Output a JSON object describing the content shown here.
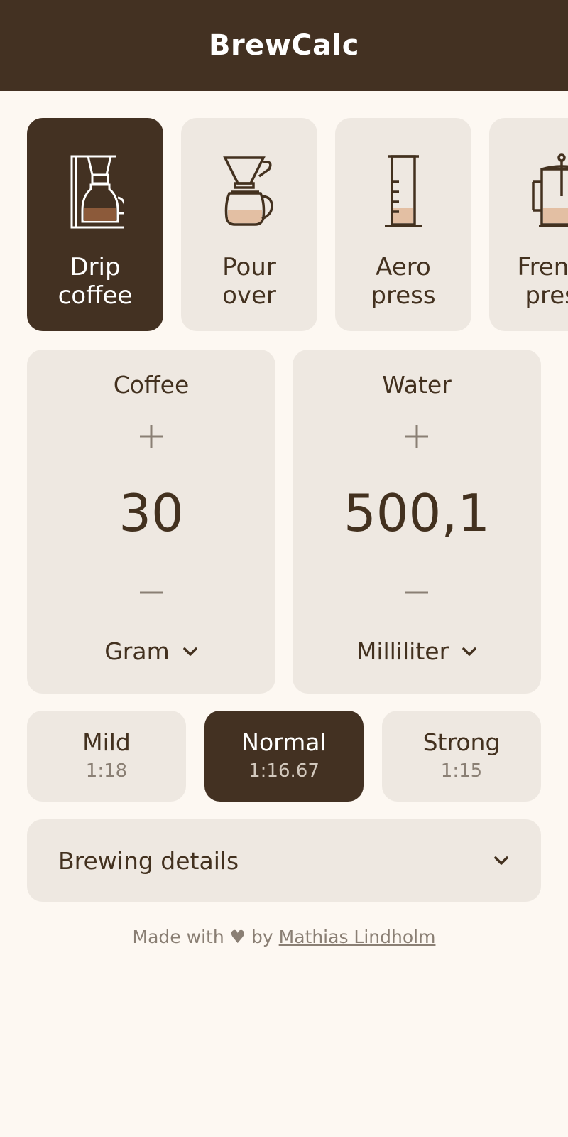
{
  "app": {
    "title": "BrewCalc"
  },
  "methods": [
    {
      "label": "Drip\ncoffee",
      "icon": "drip-coffee-maker-icon",
      "active": true
    },
    {
      "label": "Pour\nover",
      "icon": "pour-over-icon",
      "active": false
    },
    {
      "label": "Aero\npress",
      "icon": "aeropress-icon",
      "active": false
    },
    {
      "label": "French\npress",
      "icon": "french-press-icon",
      "active": false
    }
  ],
  "coffee": {
    "title": "Coffee",
    "value": "30",
    "unit": "Gram"
  },
  "water": {
    "title": "Water",
    "value": "500,1",
    "unit": "Milliliter"
  },
  "strengths": [
    {
      "name": "Mild",
      "ratio": "1:18",
      "active": false
    },
    {
      "name": "Normal",
      "ratio": "1:16.67",
      "active": true
    },
    {
      "name": "Strong",
      "ratio": "1:15",
      "active": false
    }
  ],
  "details": {
    "title": "Brewing details"
  },
  "footer": {
    "prefix": "Made with",
    "heart": "♥",
    "by": "by",
    "author": "Mathias Lindholm"
  },
  "colors": {
    "primary": "#433122",
    "card": "#eee8e1",
    "background": "#fdf8f2",
    "accent": "#e3bfa3",
    "muted": "#8a7f74"
  }
}
